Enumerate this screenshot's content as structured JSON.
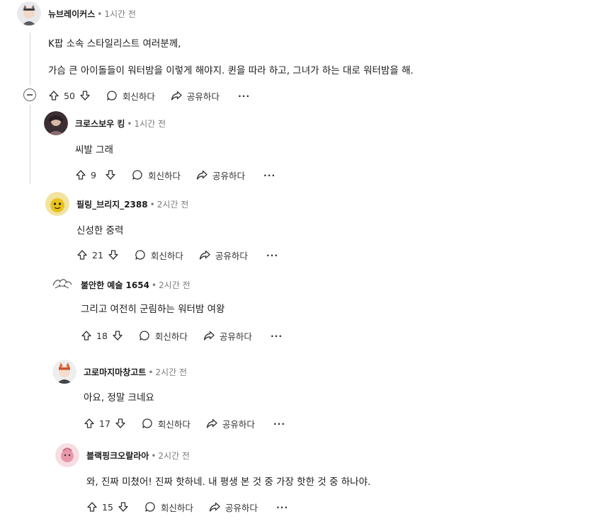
{
  "comments": [
    {
      "user": "뉴브레이커스",
      "time": "1시간 전",
      "lines": [
        "K팝 소속 스타일리스트 여러분께,",
        "가슴 큰 아이돌들이 워터밤을 이렇게 해야지. 퀸을 따라 하고, 그녀가 하는 대로 워터밤을 해."
      ],
      "score": "50",
      "reply": "회신하다",
      "share": "공유하다",
      "more": "···"
    },
    {
      "user": "크로스보우 킹",
      "time": "1시간 전",
      "lines": [
        "씨발 그래"
      ],
      "score": "9",
      "reply": "회신하다",
      "share": "공유하다",
      "more": "···"
    },
    {
      "user": "필링_브리지_2388",
      "time": "2시간 전",
      "lines": [
        "신성한 중력"
      ],
      "score": "21",
      "reply": "회신하다",
      "share": "공유하다",
      "more": "···"
    },
    {
      "user": "불안한 예술 1654",
      "time": "2시간 전",
      "lines": [
        "그리고 여전히 군림하는 워터밤 여왕"
      ],
      "score": "18",
      "reply": "회신하다",
      "share": "공유하다",
      "more": "···"
    },
    {
      "user": "고로마지마창고트",
      "time": "2시간 전",
      "lines": [
        "아요, 정말 크네요"
      ],
      "score": "17",
      "reply": "회신하다",
      "share": "공유하다",
      "more": "···"
    },
    {
      "user": "블랙핑크오랄라아",
      "time": "2시간 전",
      "lines": [
        "와, 진짜 미쳤어! 진짜 핫하네. 내 평생 본 것 중 가장 핫한 것 중 하나야."
      ],
      "score": "15",
      "reply": "회신하다",
      "share": "공유하다",
      "more": "···"
    }
  ],
  "separator": "•",
  "icons": {
    "upvote": "arrow-up-icon",
    "downvote": "arrow-down-icon",
    "reply": "speech-bubble-icon",
    "share": "share-arrow-icon",
    "collapse": "minus-circle-icon"
  },
  "colors": {
    "text": "#1c1c1c",
    "meta": "#7c7c7c",
    "thread_line": "#d0d4d8"
  }
}
